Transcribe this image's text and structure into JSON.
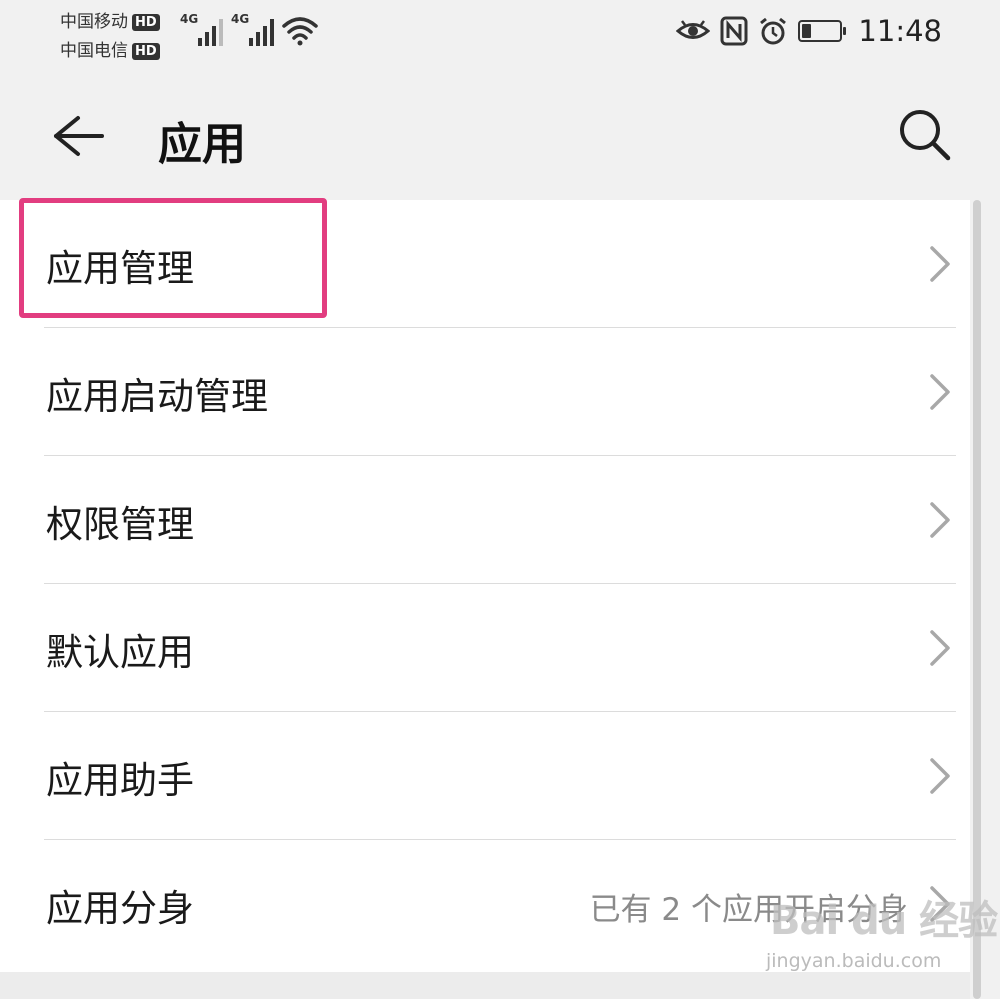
{
  "status_bar": {
    "carriers": [
      {
        "name": "中国移动",
        "badge": "HD"
      },
      {
        "name": "中国电信",
        "badge": "HD"
      }
    ],
    "network_labels": [
      "4G",
      "4G"
    ],
    "time": "11:48",
    "battery_level": 0.25,
    "icons": [
      "eye-comfort-icon",
      "nfc-icon",
      "alarm-icon",
      "wifi-icon",
      "battery-icon"
    ]
  },
  "app_bar": {
    "title": "应用",
    "back_icon": "back-arrow-icon",
    "search_icon": "search-icon"
  },
  "list": {
    "items": [
      {
        "label": "应用管理",
        "value": ""
      },
      {
        "label": "应用启动管理",
        "value": ""
      },
      {
        "label": "权限管理",
        "value": ""
      },
      {
        "label": "默认应用",
        "value": ""
      },
      {
        "label": "应用助手",
        "value": ""
      },
      {
        "label": "应用分身",
        "value": "已有 2 个应用开启分身"
      }
    ],
    "highlight_color": "#e23d80"
  },
  "watermark": {
    "logo": "Bai du 经验",
    "url": "jingyan.baidu.com"
  }
}
